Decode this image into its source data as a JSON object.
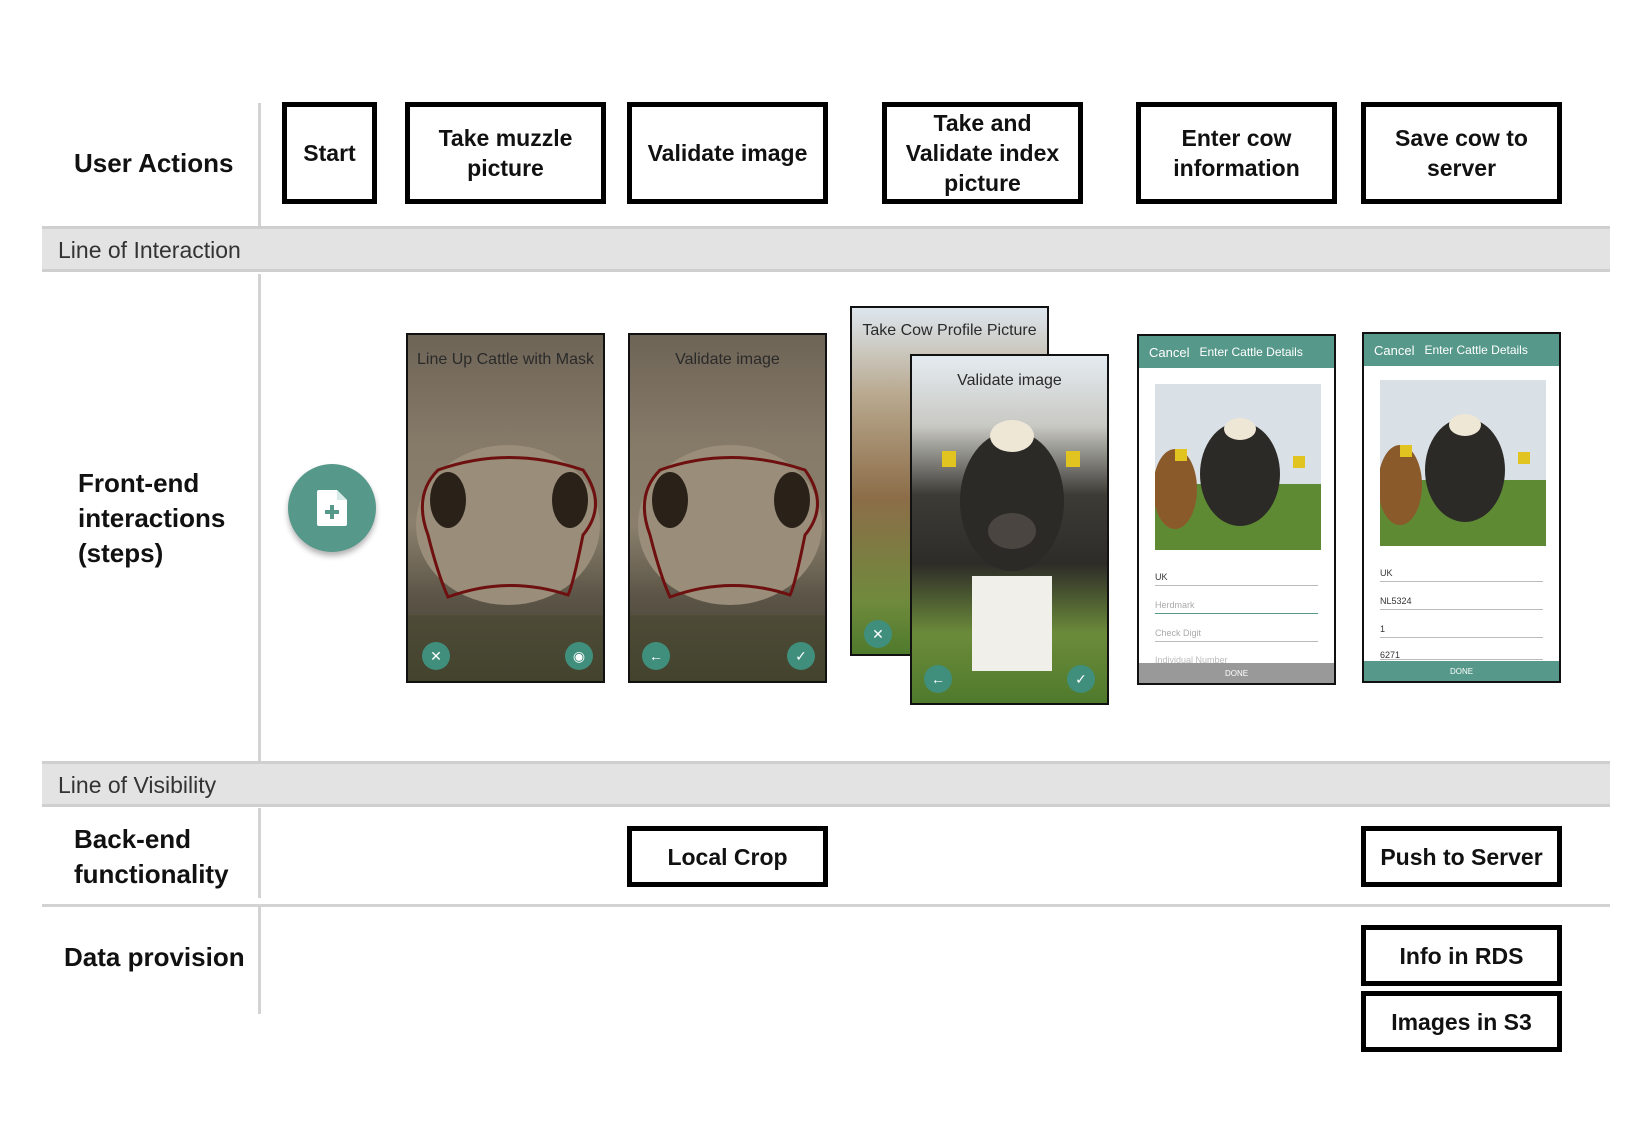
{
  "lanes": {
    "user_actions": "User Actions",
    "line_of_interaction": "Line of Interaction",
    "frontend": "Front-end interactions (steps)",
    "line_of_visibility": "Line of Visibility",
    "backend": "Back-end functionality",
    "data_provision": "Data provision"
  },
  "actions": {
    "start": "Start",
    "muzzle": "Take muzzle picture",
    "validate": "Validate image",
    "index": "Take and Validate index picture",
    "enter": "Enter cow information",
    "save": "Save cow to server"
  },
  "screens": {
    "muzzle_title": "Line Up Cattle with Mask",
    "validate_title": "Validate image",
    "profile_title": "Take Cow Profile Picture",
    "profile_validate_title": "Validate image",
    "form_cancel": "Cancel",
    "form_title": "Enter Cattle Details",
    "form_enter_fields": [
      "UK",
      "Herdmark",
      "Check Digit",
      "Individual Number"
    ],
    "form_save_fields": [
      "UK",
      "NL5324",
      "1",
      "6271"
    ],
    "done": "DONE"
  },
  "backend": {
    "local_crop": "Local Crop",
    "push": "Push to Server"
  },
  "data": {
    "rds": "Info in RDS",
    "s3": "Images in S3"
  },
  "colors": {
    "accent": "#56988a",
    "band": "#e3e3e3",
    "mask_outline": "#6e1010"
  }
}
